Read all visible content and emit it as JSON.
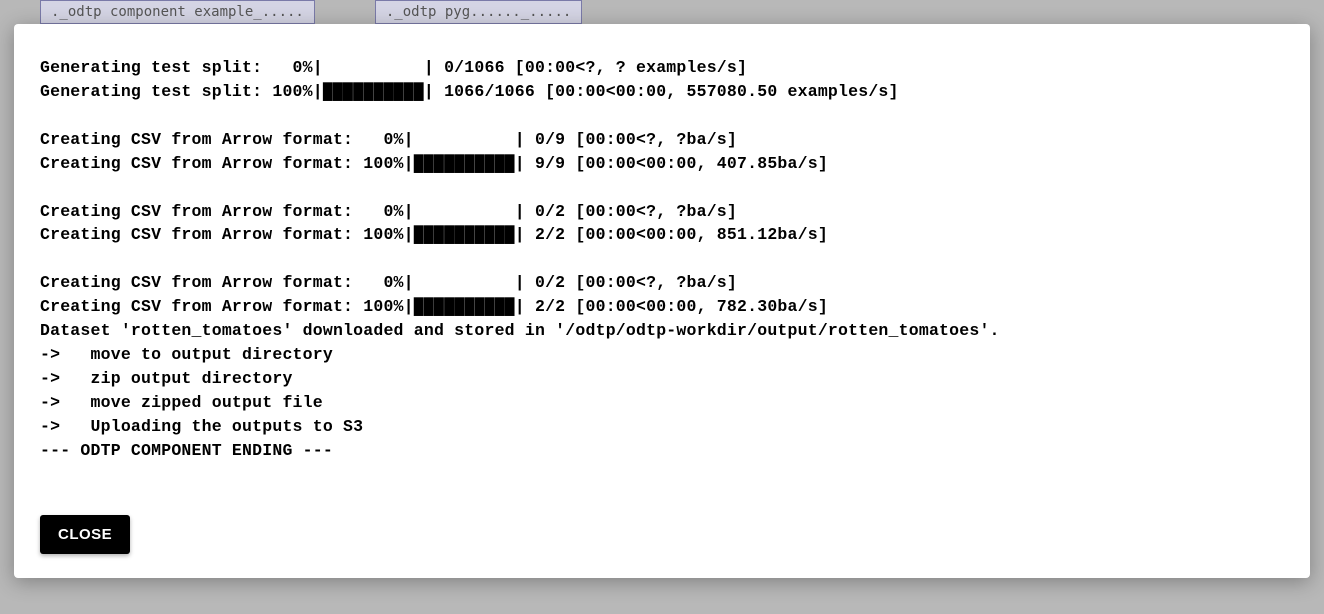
{
  "bg": {
    "tab1": "._odtp component example_.....",
    "tab2": "._odtp pyg......_....."
  },
  "log": {
    "lines": [
      "Generating test split:   0%|          | 0/1066 [00:00<?, ? examples/s]",
      "Generating test split: 100%|██████████| 1066/1066 [00:00<00:00, 557080.50 examples/s]",
      "",
      "Creating CSV from Arrow format:   0%|          | 0/9 [00:00<?, ?ba/s]",
      "Creating CSV from Arrow format: 100%|██████████| 9/9 [00:00<00:00, 407.85ba/s]",
      "",
      "Creating CSV from Arrow format:   0%|          | 0/2 [00:00<?, ?ba/s]",
      "Creating CSV from Arrow format: 100%|██████████| 2/2 [00:00<00:00, 851.12ba/s]",
      "",
      "Creating CSV from Arrow format:   0%|          | 0/2 [00:00<?, ?ba/s]",
      "Creating CSV from Arrow format: 100%|██████████| 2/2 [00:00<00:00, 782.30ba/s]",
      "Dataset 'rotten_tomatoes' downloaded and stored in '/odtp/odtp-workdir/output/rotten_tomatoes'.",
      "->   move to output directory",
      "->   zip output directory",
      "->   move zipped output file",
      "->   Uploading the outputs to S3",
      "--- ODTP COMPONENT ENDING ---"
    ]
  },
  "buttons": {
    "close": "CLOSE"
  }
}
